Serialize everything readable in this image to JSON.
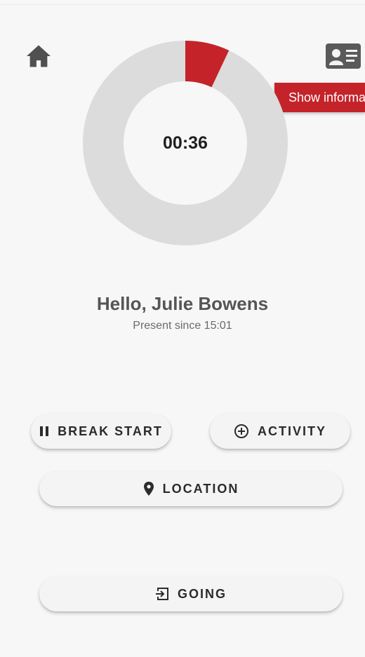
{
  "header": {
    "home_icon": "home-icon",
    "info_icon": "id-card-icon",
    "tooltip": "Show informa"
  },
  "timer": {
    "display": "00:36",
    "progress_fraction": 0.07,
    "accent_color": "#c4232a",
    "track_color": "#dcdcdc"
  },
  "user": {
    "greeting": "Hello, Julie Bowens",
    "status": "Present since 15:01"
  },
  "actions": {
    "break_start": {
      "label": "BREAK START",
      "icon": "pause-icon"
    },
    "activity": {
      "label": "ACTIVITY",
      "icon": "plus-circle-icon"
    },
    "location": {
      "label": "LOCATION",
      "icon": "location-pin-icon"
    },
    "going": {
      "label": "GOING",
      "icon": "logout-icon"
    }
  }
}
